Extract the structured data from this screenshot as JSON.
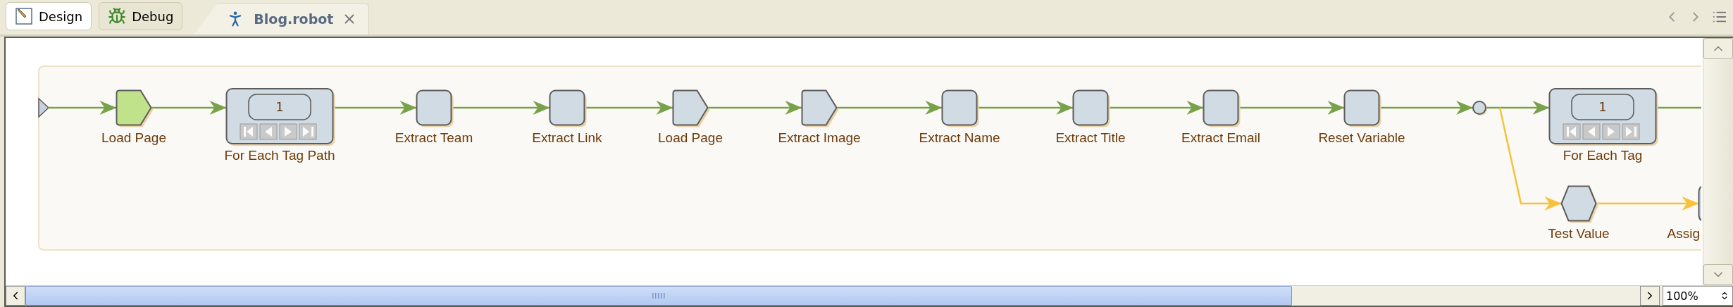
{
  "perspective_tabs": [
    {
      "label": "Design",
      "selected": true
    },
    {
      "label": "Debug",
      "selected": false
    }
  ],
  "editor_tabs": [
    {
      "title": "Blog.robot",
      "selected": true
    }
  ],
  "diagram": {
    "steps": [
      {
        "kind": "page",
        "label": "Load Page",
        "selected": true
      },
      {
        "kind": "loop",
        "label": "For Each Tag Path",
        "counter": "1",
        "selected": false
      },
      {
        "kind": "action",
        "label": "Extract Team",
        "selected": false
      },
      {
        "kind": "action",
        "label": "Extract Link",
        "selected": false
      },
      {
        "kind": "page",
        "label": "Load Page",
        "selected": false
      },
      {
        "kind": "page",
        "label": "Extract Image",
        "selected": false
      },
      {
        "kind": "action",
        "label": "Extract Name",
        "selected": false
      },
      {
        "kind": "action",
        "label": "Extract Title",
        "selected": false
      },
      {
        "kind": "action",
        "label": "Extract Email",
        "selected": false
      },
      {
        "kind": "action",
        "label": "Reset Variable",
        "selected": false
      },
      {
        "kind": "junction",
        "selected": false
      },
      {
        "kind": "loop",
        "label": "For Each Tag",
        "counter": "1",
        "selected": false
      }
    ],
    "branch": [
      {
        "kind": "condition",
        "label": "Test Value",
        "selected": false
      },
      {
        "kind": "action",
        "label": "Assig",
        "selected": false
      }
    ]
  },
  "zoom": {
    "value": "100%"
  }
}
